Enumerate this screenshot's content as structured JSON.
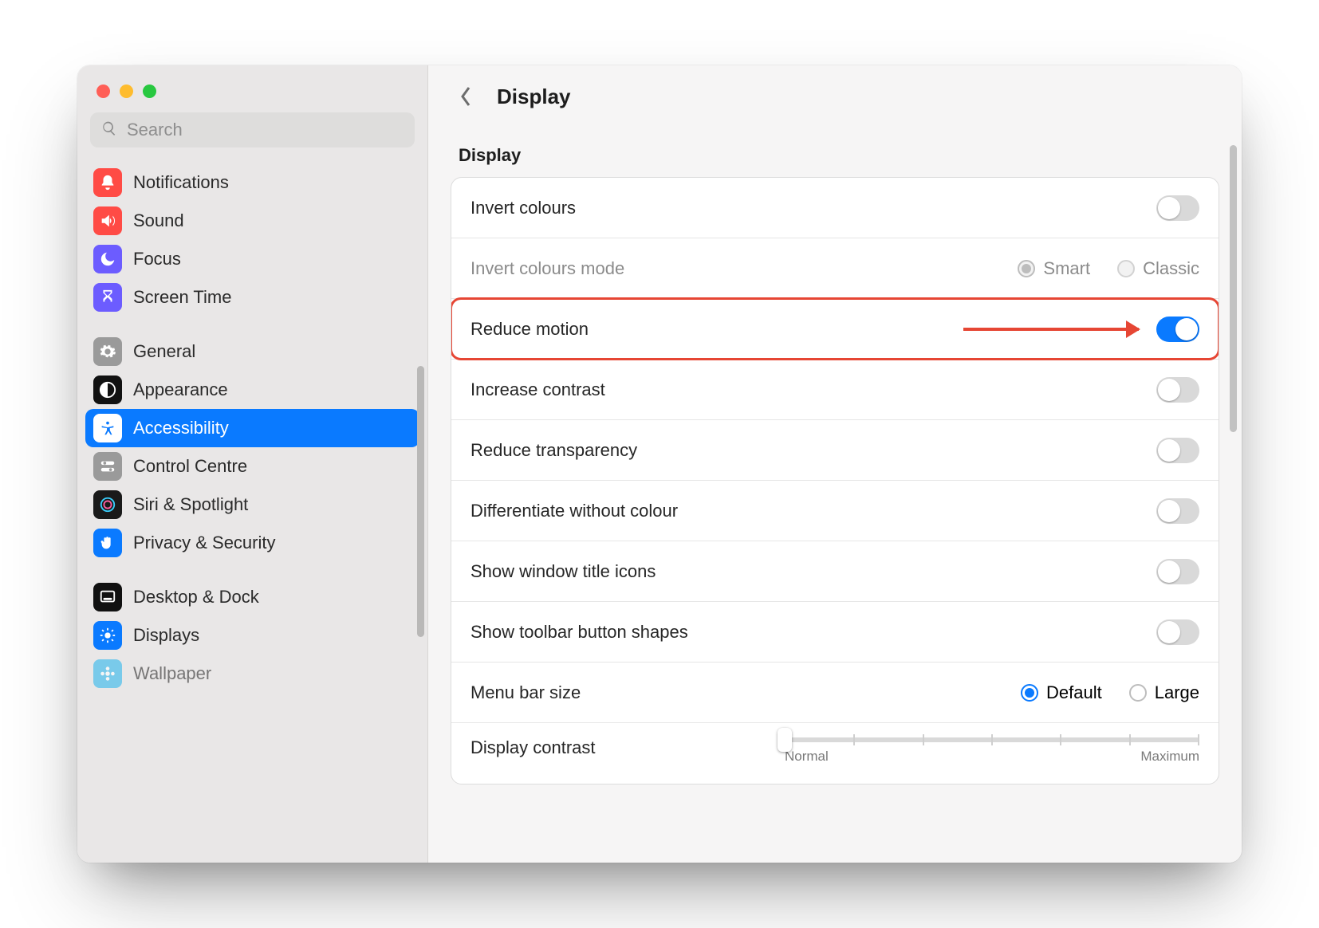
{
  "window": {
    "title": "Display"
  },
  "sidebar": {
    "search_placeholder": "Search",
    "groups": [
      [
        {
          "id": "notifications",
          "label": "Notifications",
          "icon": "bell-icon",
          "color": "ic-notifications"
        },
        {
          "id": "sound",
          "label": "Sound",
          "icon": "speaker-icon",
          "color": "ic-sound"
        },
        {
          "id": "focus",
          "label": "Focus",
          "icon": "moon-icon",
          "color": "ic-focus"
        },
        {
          "id": "screentime",
          "label": "Screen Time",
          "icon": "hourglass-icon",
          "color": "ic-screentime"
        }
      ],
      [
        {
          "id": "general",
          "label": "General",
          "icon": "gear-icon",
          "color": "ic-general"
        },
        {
          "id": "appearance",
          "label": "Appearance",
          "icon": "contrast-icon",
          "color": "ic-appearance"
        },
        {
          "id": "accessibility",
          "label": "Accessibility",
          "icon": "accessibility-icon",
          "color": "ic-accessibility",
          "selected": true
        },
        {
          "id": "controlcentre",
          "label": "Control Centre",
          "icon": "switches-icon",
          "color": "ic-controlcentre"
        },
        {
          "id": "siri",
          "label": "Siri & Spotlight",
          "icon": "siri-icon",
          "color": "ic-siri"
        },
        {
          "id": "privacy",
          "label": "Privacy & Security",
          "icon": "hand-icon",
          "color": "ic-privacy"
        }
      ],
      [
        {
          "id": "desktop",
          "label": "Desktop & Dock",
          "icon": "dock-icon",
          "color": "ic-desktop"
        },
        {
          "id": "displays",
          "label": "Displays",
          "icon": "sun-icon",
          "color": "ic-displays"
        },
        {
          "id": "wallpaper",
          "label": "Wallpaper",
          "icon": "flower-icon",
          "color": "ic-wallpaper"
        }
      ]
    ]
  },
  "content": {
    "page_title": "Display",
    "section_label": "Display",
    "rows": {
      "invert_colours": {
        "label": "Invert colours",
        "on": false
      },
      "invert_mode": {
        "label": "Invert colours mode",
        "disabled": true,
        "options": [
          {
            "label": "Smart",
            "checked": true
          },
          {
            "label": "Classic",
            "checked": false
          }
        ]
      },
      "reduce_motion": {
        "label": "Reduce motion",
        "on": true,
        "highlighted": true
      },
      "increase_contrast": {
        "label": "Increase contrast",
        "on": false
      },
      "reduce_transparency": {
        "label": "Reduce transparency",
        "on": false
      },
      "diff_colour": {
        "label": "Differentiate without colour",
        "on": false
      },
      "title_icons": {
        "label": "Show window title icons",
        "on": false
      },
      "toolbar_shapes": {
        "label": "Show toolbar button shapes",
        "on": false
      },
      "menubar_size": {
        "label": "Menu bar size",
        "options": [
          {
            "label": "Default",
            "checked": true
          },
          {
            "label": "Large",
            "checked": false
          }
        ]
      },
      "display_contrast": {
        "label": "Display contrast",
        "min_label": "Normal",
        "max_label": "Maximum",
        "value": 0
      }
    }
  }
}
